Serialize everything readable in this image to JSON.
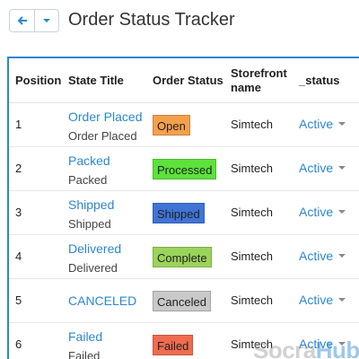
{
  "header": {
    "title": "Order Status Tracker"
  },
  "table": {
    "columns": {
      "position": "Position",
      "state_title": "State Title",
      "order_status": "Order Status",
      "storefront_l1": "Storefront",
      "storefront_l2": "name",
      "status": "_status"
    },
    "rows": [
      {
        "position": "1",
        "title": "Order Placed",
        "subtitle": "Order Placed",
        "order_status": "Open",
        "badge_color": "#f5a04c",
        "storefront": "Simtech",
        "status": "Active"
      },
      {
        "position": "2",
        "title": "Packed",
        "subtitle": "Packed",
        "order_status": "Processed",
        "badge_color": "#5ce23a",
        "storefront": "Simtech",
        "status": "Active"
      },
      {
        "position": "3",
        "title": "Shipped",
        "subtitle": "Shipped",
        "order_status": "Shipped",
        "badge_color": "#3f74d6",
        "storefront": "Simtech",
        "status": "Active"
      },
      {
        "position": "4",
        "title": "Delivered",
        "subtitle": "Delivered",
        "order_status": "Complete",
        "badge_color": "#9bd45a",
        "storefront": "Simtech",
        "status": "Active"
      },
      {
        "position": "5",
        "title": "CANCELED",
        "subtitle": "",
        "order_status": "Canceled",
        "badge_color": "#c9c9c9",
        "storefront": "Simtech",
        "status": "Active"
      },
      {
        "position": "6",
        "title": "Failed",
        "subtitle": "Failed",
        "order_status": "Failed",
        "badge_color": "#f06b4f",
        "storefront": "Simtech",
        "status": "Active"
      }
    ]
  },
  "watermark": {
    "part1": "Socra",
    "part2": "Hub"
  },
  "colors": {
    "accent": "#2b87d1"
  }
}
